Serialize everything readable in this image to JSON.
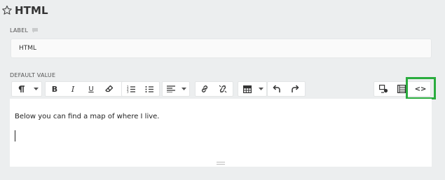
{
  "title": "HTML",
  "fields": {
    "label": {
      "caption": "LABEL",
      "value": "HTML"
    },
    "default_value": {
      "caption": "DEFAULT VALUE",
      "content": "Below you can find a map of where I live."
    }
  },
  "toolbar": {
    "paragraph_icon": "pilcrow-icon",
    "buttons": [
      "bold-icon",
      "italic-icon",
      "underline-icon",
      "eraser-icon",
      "ordered-list-icon",
      "unordered-list-icon",
      "align-icon",
      "link-icon",
      "unlink-icon",
      "table-icon",
      "undo-icon",
      "redo-icon",
      "media-icon",
      "template-icon",
      "code-view-icon"
    ],
    "bold": "B",
    "italic": "I",
    "underline": "U",
    "code_view": "<>"
  },
  "colors": {
    "highlight": "#2aac3e",
    "background": "#eceeef"
  }
}
